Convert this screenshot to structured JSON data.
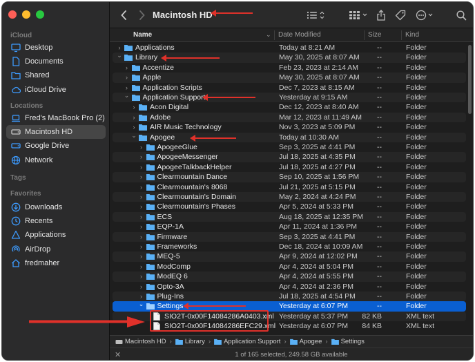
{
  "window": {
    "title": "Macintosh HD"
  },
  "sidebar": {
    "sections": [
      {
        "label": "iCloud",
        "items": [
          {
            "label": "Desktop",
            "icon": "desktop-icon"
          },
          {
            "label": "Documents",
            "icon": "documents-icon"
          },
          {
            "label": "Shared",
            "icon": "shared-folder-icon"
          },
          {
            "label": "iCloud Drive",
            "icon": "icloud-icon"
          }
        ]
      },
      {
        "label": "Locations",
        "items": [
          {
            "label": "Fred's MacBook Pro (2)",
            "icon": "laptop-icon"
          },
          {
            "label": "Macintosh HD",
            "icon": "hard-drive-icon",
            "selected": true
          },
          {
            "label": "Google Drive",
            "icon": "drive-icon"
          },
          {
            "label": "Network",
            "icon": "network-icon"
          }
        ]
      },
      {
        "label": "Tags",
        "items": []
      },
      {
        "label": "Favorites",
        "items": [
          {
            "label": "Downloads",
            "icon": "downloads-icon"
          },
          {
            "label": "Recents",
            "icon": "clock-icon"
          },
          {
            "label": "Applications",
            "icon": "applications-icon"
          },
          {
            "label": "AirDrop",
            "icon": "airdrop-icon"
          },
          {
            "label": "fredmaher",
            "icon": "home-icon"
          }
        ]
      }
    ]
  },
  "columns": {
    "name": "Name",
    "date": "Date Modified",
    "size": "Size",
    "kind": "Kind"
  },
  "rows": [
    {
      "name": "Applications",
      "date": "Today at 8:21 AM",
      "size": "--",
      "kind": "Folder",
      "depth": 0,
      "expanded": false,
      "type": "folder"
    },
    {
      "name": "Library",
      "date": "May 30, 2025 at 8:07 AM",
      "size": "--",
      "kind": "Folder",
      "depth": 0,
      "expanded": true,
      "type": "folder"
    },
    {
      "name": "Accentize",
      "date": "Feb 23, 2023 at 2:14 AM",
      "size": "--",
      "kind": "Folder",
      "depth": 1,
      "expanded": false,
      "type": "folder"
    },
    {
      "name": "Apple",
      "date": "May 30, 2025 at 8:07 AM",
      "size": "--",
      "kind": "Folder",
      "depth": 1,
      "expanded": false,
      "type": "folder"
    },
    {
      "name": "Application Scripts",
      "date": "Dec 7, 2023 at 8:15 AM",
      "size": "--",
      "kind": "Folder",
      "depth": 1,
      "expanded": false,
      "type": "folder"
    },
    {
      "name": "Application Support",
      "date": "Yesterday at 9:15 AM",
      "size": "--",
      "kind": "Folder",
      "depth": 1,
      "expanded": true,
      "type": "folder"
    },
    {
      "name": "Acon Digital",
      "date": "Dec 12, 2023 at 8:40 AM",
      "size": "--",
      "kind": "Folder",
      "depth": 2,
      "expanded": false,
      "type": "folder"
    },
    {
      "name": "Adobe",
      "date": "Mar 12, 2023 at 11:49 AM",
      "size": "--",
      "kind": "Folder",
      "depth": 2,
      "expanded": false,
      "type": "folder"
    },
    {
      "name": "AIR Music Technology",
      "date": "Nov 3, 2023 at 5:09 PM",
      "size": "--",
      "kind": "Folder",
      "depth": 2,
      "expanded": false,
      "type": "folder"
    },
    {
      "name": "Apogee",
      "date": "Today at 10:30 AM",
      "size": "--",
      "kind": "Folder",
      "depth": 2,
      "expanded": true,
      "type": "folder"
    },
    {
      "name": "ApogeeGlue",
      "date": "Sep 3, 2025 at 4:41 PM",
      "size": "--",
      "kind": "Folder",
      "depth": 3,
      "expanded": false,
      "type": "folder"
    },
    {
      "name": "ApogeeMessenger",
      "date": "Jul 18, 2025 at 4:35 PM",
      "size": "--",
      "kind": "Folder",
      "depth": 3,
      "expanded": false,
      "type": "folder"
    },
    {
      "name": "ApogeeTalkbackHelper",
      "date": "Jul 18, 2025 at 4:27 PM",
      "size": "--",
      "kind": "Folder",
      "depth": 3,
      "expanded": false,
      "type": "folder"
    },
    {
      "name": "Clearmountain Dance",
      "date": "Sep 10, 2025 at 1:56 PM",
      "size": "--",
      "kind": "Folder",
      "depth": 3,
      "expanded": false,
      "type": "folder"
    },
    {
      "name": "Clearmountain's 8068",
      "date": "Jul 21, 2025 at 5:15 PM",
      "size": "--",
      "kind": "Folder",
      "depth": 3,
      "expanded": false,
      "type": "folder"
    },
    {
      "name": "Clearmountain's Domain",
      "date": "May 2, 2024 at 4:24 PM",
      "size": "--",
      "kind": "Folder",
      "depth": 3,
      "expanded": false,
      "type": "folder"
    },
    {
      "name": "Clearmountain's Phases",
      "date": "Apr 5, 2024 at 5:33 PM",
      "size": "--",
      "kind": "Folder",
      "depth": 3,
      "expanded": false,
      "type": "folder"
    },
    {
      "name": "ECS",
      "date": "Aug 18, 2025 at 12:35 PM",
      "size": "--",
      "kind": "Folder",
      "depth": 3,
      "expanded": false,
      "type": "folder"
    },
    {
      "name": "EQP-1A",
      "date": "Apr 11, 2024 at 1:36 PM",
      "size": "--",
      "kind": "Folder",
      "depth": 3,
      "expanded": false,
      "type": "folder"
    },
    {
      "name": "Firmware",
      "date": "Sep 3, 2025 at 4:41 PM",
      "size": "--",
      "kind": "Folder",
      "depth": 3,
      "expanded": false,
      "type": "folder"
    },
    {
      "name": "Frameworks",
      "date": "Dec 18, 2024 at 10:09 AM",
      "size": "--",
      "kind": "Folder",
      "depth": 3,
      "expanded": false,
      "type": "folder"
    },
    {
      "name": "MEQ-5",
      "date": "Apr 9, 2024 at 12:02 PM",
      "size": "--",
      "kind": "Folder",
      "depth": 3,
      "expanded": false,
      "type": "folder"
    },
    {
      "name": "ModComp",
      "date": "Apr 4, 2024 at 5:04 PM",
      "size": "--",
      "kind": "Folder",
      "depth": 3,
      "expanded": false,
      "type": "folder"
    },
    {
      "name": "ModEQ 6",
      "date": "Apr 4, 2024 at 5:55 PM",
      "size": "--",
      "kind": "Folder",
      "depth": 3,
      "expanded": false,
      "type": "folder"
    },
    {
      "name": "Opto-3A",
      "date": "Apr 4, 2024 at 2:36 PM",
      "size": "--",
      "kind": "Folder",
      "depth": 3,
      "expanded": false,
      "type": "folder"
    },
    {
      "name": "Plug-Ins",
      "date": "Jul 18, 2025 at 4:54 PM",
      "size": "--",
      "kind": "Folder",
      "depth": 3,
      "expanded": false,
      "type": "folder"
    },
    {
      "name": "Settings",
      "date": "Yesterday at 6:07 PM",
      "size": "--",
      "kind": "Folder",
      "depth": 3,
      "expanded": true,
      "type": "folder",
      "selected": true
    },
    {
      "name": "SIO2T-0x00F14084286A0403.xml",
      "date": "Yesterday at 5:37 PM",
      "size": "82 KB",
      "kind": "XML text",
      "depth": 4,
      "type": "file"
    },
    {
      "name": "SIO2T-0x00F14084286EFC29.xml",
      "date": "Yesterday at 6:07 PM",
      "size": "84 KB",
      "kind": "XML text",
      "depth": 4,
      "type": "file"
    }
  ],
  "pathbar": [
    "Macintosh HD",
    "Library",
    "Application Support",
    "Apogee",
    "Settings"
  ],
  "status": {
    "text": "1 of 165 selected, 249.58 GB available"
  },
  "colors": {
    "selection": "#0a5fd1",
    "folder": "#5ab0f5",
    "annotation": "#e0312a",
    "sidebar_icon": "#3d9bff"
  }
}
